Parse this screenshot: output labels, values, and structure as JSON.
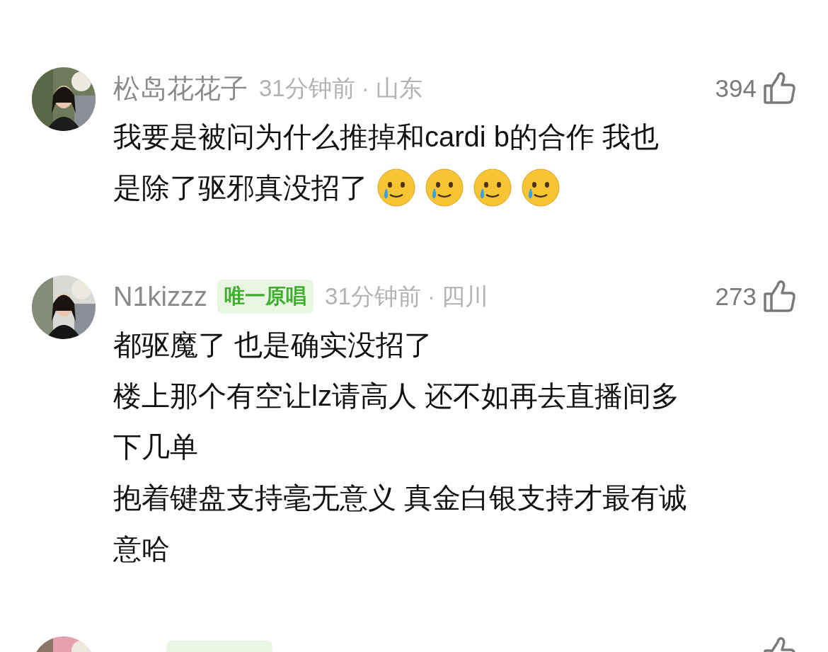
{
  "comments": [
    {
      "kind": "full",
      "name": "松岛花花子",
      "time": "31分钟前 · 山东",
      "likes": "394",
      "lines": [
        [
          {
            "kind": "text",
            "text": "我要是被问为什么推掉和cardi b的合作 我也"
          }
        ],
        [
          {
            "kind": "text",
            "text": "是除了驱邪真没招了"
          },
          {
            "kind": "emoji"
          },
          {
            "kind": "emoji"
          },
          {
            "kind": "emoji"
          },
          {
            "kind": "emoji"
          }
        ]
      ]
    },
    {
      "kind": "full",
      "name": "N1kizzz",
      "badge": "唯一原唱",
      "time": "31分钟前 · 四川",
      "likes": "273",
      "lines": [
        [
          {
            "kind": "text",
            "text": "都驱魔了 也是确实没招了"
          }
        ],
        [
          {
            "kind": "text",
            "text": "楼上那个有空让lz请高人 还不如再去直播间多"
          }
        ],
        [
          {
            "kind": "text",
            "text": "下几单"
          }
        ],
        [
          {
            "kind": "text",
            "text": "抱着键盘支持毫无意义 真金白银支持才最有诚"
          }
        ],
        [
          {
            "kind": "text",
            "text": "意哈"
          }
        ]
      ]
    },
    {
      "kind": "cut_off"
    }
  ]
}
